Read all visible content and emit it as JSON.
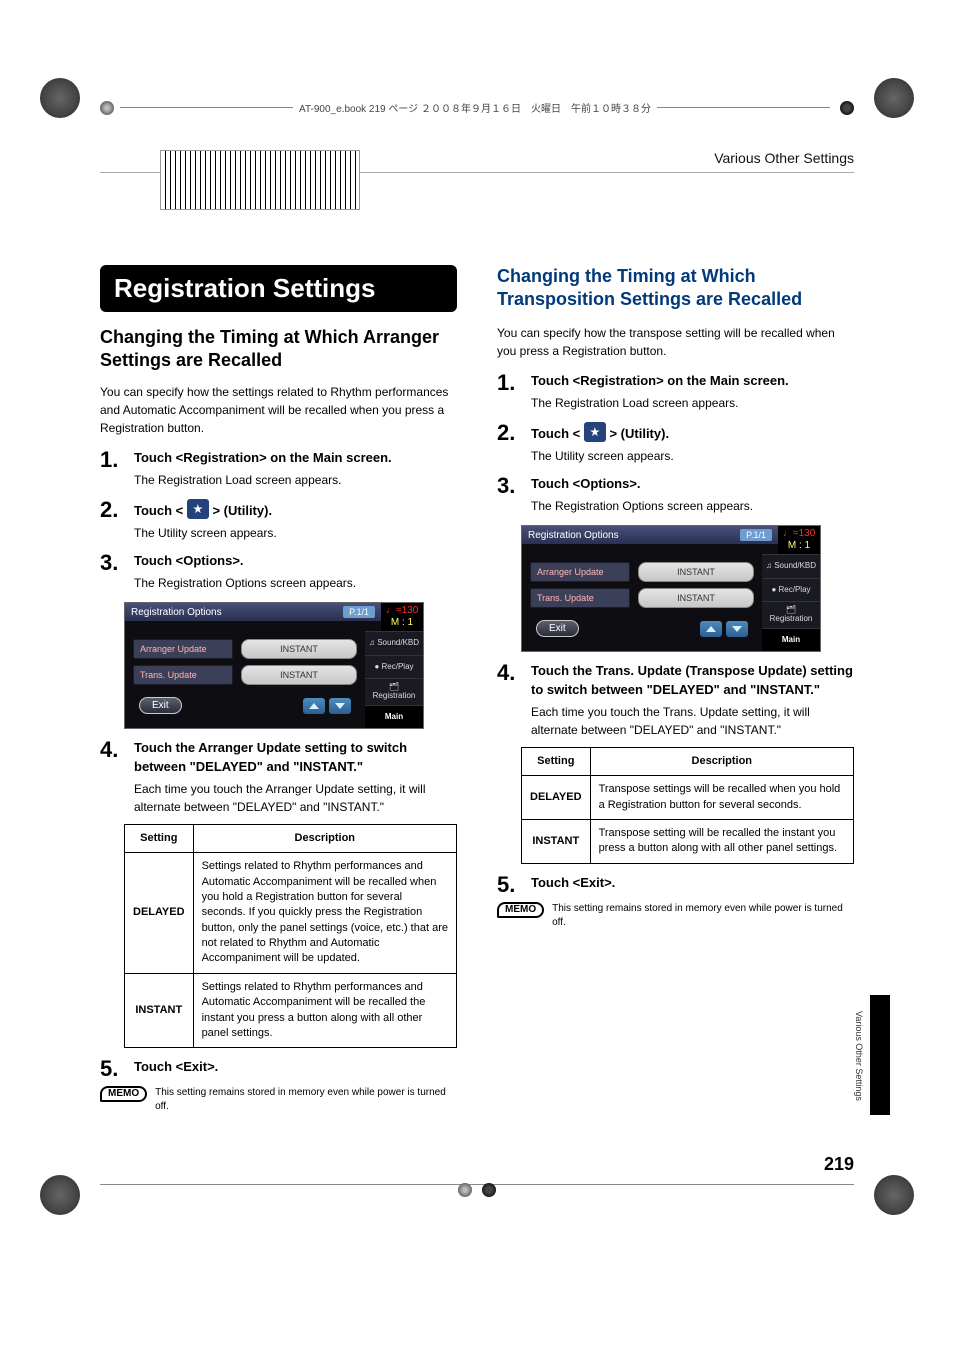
{
  "header_note": "AT-900_e.book  219 ページ  ２００８年９月１６日　火曜日　午前１０時３８分",
  "breadcrumb": "Various Other Settings",
  "side_tab_label": "Various Other Settings",
  "page_number": "219",
  "memo_badge": "MEMO",
  "left": {
    "main_title": "Registration Settings",
    "sub_title": "Changing the Timing at Which Arranger Settings are Recalled",
    "intro": "You can specify how the settings related to Rhythm performances and Automatic Accompaniment will be recalled when you press a Registration button.",
    "steps": [
      {
        "num": "1.",
        "title": "Touch <Registration> on the Main screen.",
        "desc": "The Registration Load screen appears."
      },
      {
        "num": "2.",
        "title_pre": "Touch < ",
        "title_post": " > (Utility).",
        "desc": "The Utility screen appears."
      },
      {
        "num": "3.",
        "title": "Touch <Options>.",
        "desc": "The Registration Options screen appears."
      },
      {
        "num": "4.",
        "title": "Touch the Arranger Update setting to switch between \"DELAYED\" and \"INSTANT.\"",
        "desc": "Each time you touch the Arranger Update setting, it will alternate between \"DELAYED\" and \"INSTANT.\""
      },
      {
        "num": "5.",
        "title": "Touch <Exit>."
      }
    ],
    "table": {
      "headers": [
        "Setting",
        "Description"
      ],
      "rows": [
        {
          "setting": "DELAYED",
          "desc": "Settings related to Rhythm performances and Automatic Accompaniment will be recalled when you hold a Registration button for several seconds. If you quickly press the Registration button, only the panel settings (voice, etc.) that are not related to Rhythm and Automatic Accompaniment will be updated."
        },
        {
          "setting": "INSTANT",
          "desc": "Settings related to Rhythm performances and Automatic Accompaniment will be recalled the instant you press a button along with all other panel settings."
        }
      ]
    },
    "memo": "This setting remains stored in memory even while power is turned off."
  },
  "right": {
    "sub_title": "Changing the Timing at Which Transposition Settings are Recalled",
    "intro": "You can specify how the transpose setting will be recalled when you press a Registration button.",
    "steps": [
      {
        "num": "1.",
        "title": "Touch <Registration> on the Main screen.",
        "desc": "The Registration Load screen appears."
      },
      {
        "num": "2.",
        "title_pre": "Touch < ",
        "title_post": " > (Utility).",
        "desc": "The Utility screen appears."
      },
      {
        "num": "3.",
        "title": "Touch <Options>.",
        "desc": "The Registration Options screen appears."
      },
      {
        "num": "4.",
        "title": "Touch the Trans. Update (Transpose Update) setting to switch between \"DELAYED\" and \"INSTANT.\"",
        "desc": "Each time you touch the Trans. Update setting, it will alternate between \"DELAYED\" and \"INSTANT.\""
      },
      {
        "num": "5.",
        "title": "Touch <Exit>."
      }
    ],
    "table": {
      "headers": [
        "Setting",
        "Description"
      ],
      "rows": [
        {
          "setting": "DELAYED",
          "desc": "Transpose settings will be recalled when you hold a Registration button for several seconds."
        },
        {
          "setting": "INSTANT",
          "desc": "Transpose setting will be recalled the instant you press a button along with all other panel settings."
        }
      ]
    },
    "memo": "This setting remains stored in memory even while power is turned off."
  },
  "screenshot": {
    "title": "Registration Options",
    "page_pill": "P.1/1",
    "tempo_top": "♩=130",
    "tempo_bot": "M :      1",
    "rows": [
      {
        "key": "Arranger Update",
        "val": "INSTANT"
      },
      {
        "key": "Trans. Update",
        "val": "INSTANT"
      }
    ],
    "side": [
      "♫ Sound/KBD",
      "● Rec/Play",
      "🗂 Registration",
      "Main"
    ],
    "exit": "Exit"
  }
}
